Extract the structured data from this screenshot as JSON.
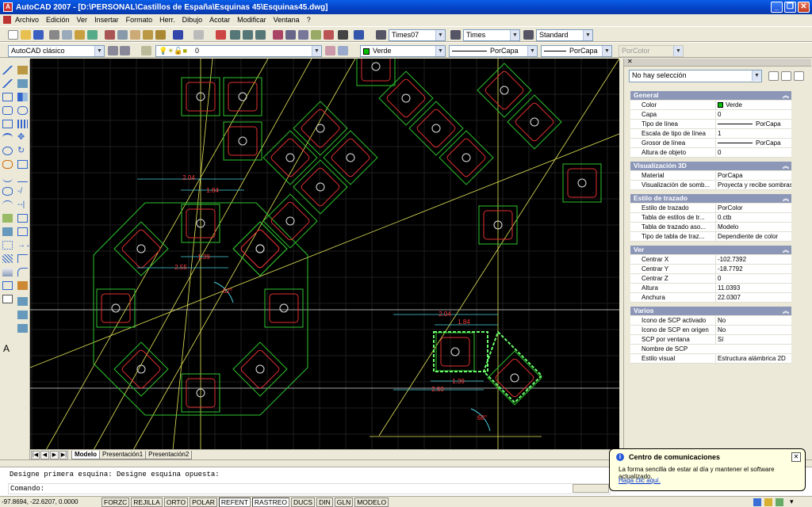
{
  "window": {
    "title": "AutoCAD 2007 - [D:\\PERSONAL\\Castillos de España\\Esquinas 45\\Esquinas45.dwg]",
    "minimize": "_",
    "restore": "❐",
    "close": "✕"
  },
  "menu": [
    "Archivo",
    "Edición",
    "Ver",
    "Insertar",
    "Formato",
    "Herr.",
    "Dibujo",
    "Acotar",
    "Modificar",
    "Ventana",
    "?"
  ],
  "toolbar1": {
    "text_style": "Times07",
    "dim_style": "Times",
    "table_style": "Standard"
  },
  "toolbar2": {
    "workspace": "AutoCAD clásico",
    "layer": "0",
    "color": "Verde",
    "color_hex": "#00ff00",
    "linetype": "PorCapa",
    "lineweight": "PorCapa",
    "plotstyle": "PorColor"
  },
  "layout_tabs": [
    "Modelo",
    "Presentación1",
    "Presentación2"
  ],
  "properties": {
    "selection": "No hay selección",
    "sections": [
      {
        "title": "General",
        "rows": [
          {
            "k": "Color",
            "v": "Verde",
            "swatch": "#00c000"
          },
          {
            "k": "Capa",
            "v": "0"
          },
          {
            "k": "Tipo de línea",
            "v": "PorCapa",
            "line": true
          },
          {
            "k": "Escala de tipo de línea",
            "v": "1"
          },
          {
            "k": "Grosor de línea",
            "v": "PorCapa",
            "line": true
          },
          {
            "k": "Altura de objeto",
            "v": "0"
          }
        ]
      },
      {
        "title": "Visualización 3D",
        "rows": [
          {
            "k": "Material",
            "v": "PorCapa"
          },
          {
            "k": "Visualización de somb...",
            "v": "Proyecta y recibe sombras"
          }
        ]
      },
      {
        "title": "Estilo de trazado",
        "rows": [
          {
            "k": "Estilo de trazado",
            "v": "PorColor"
          },
          {
            "k": "Tabla de estilos de tr...",
            "v": "0.ctb"
          },
          {
            "k": "Tabla de trazado aso...",
            "v": "Modelo"
          },
          {
            "k": "Tipo de tabla de traz...",
            "v": "Dependiente de color"
          }
        ]
      },
      {
        "title": "Ver",
        "rows": [
          {
            "k": "Centrar X",
            "v": "-102.7392"
          },
          {
            "k": "Centrar Y",
            "v": "-18.7792"
          },
          {
            "k": "Centrar Z",
            "v": "0"
          },
          {
            "k": "Altura",
            "v": "11.0393"
          },
          {
            "k": "Anchura",
            "v": "22.0307"
          }
        ]
      },
      {
        "title": "Varios",
        "rows": [
          {
            "k": "Icono de SCP activado",
            "v": "No"
          },
          {
            "k": "Icono de SCP en origen",
            "v": "No"
          },
          {
            "k": "SCP por ventana",
            "v": "Sí"
          },
          {
            "k": "Nombre de SCP",
            "v": ""
          },
          {
            "k": "Estilo visual",
            "v": "Estructura alámbrica 2D"
          }
        ]
      }
    ]
  },
  "command": {
    "history": "Designe primera esquina: Designe esquina opuesta:",
    "prompt": "Comando:"
  },
  "status": {
    "coords": "-97.8694, -22.6207, 0.0000",
    "buttons": [
      {
        "label": "FORZC",
        "on": false
      },
      {
        "label": "REJILLA",
        "on": false
      },
      {
        "label": "ORTO",
        "on": false
      },
      {
        "label": "POLAR",
        "on": false
      },
      {
        "label": "REFENT",
        "on": true
      },
      {
        "label": "RASTREO",
        "on": true
      },
      {
        "label": "DUCS",
        "on": false
      },
      {
        "label": "DIN",
        "on": false
      },
      {
        "label": "GLN",
        "on": false
      },
      {
        "label": "MODELO",
        "on": false
      }
    ]
  },
  "balloon": {
    "title": "Centro de comunicaciones",
    "body": "La forma sencilla de estar al día y mantener el software actualizado.",
    "link": "Haga clic aquí.",
    "close": "✕"
  },
  "drawing": {
    "dims": [
      "2.04",
      "1.84",
      "1.39",
      "2.55",
      "62°",
      "2.04",
      "1.84",
      "1.39",
      "2.50",
      "68°"
    ]
  }
}
